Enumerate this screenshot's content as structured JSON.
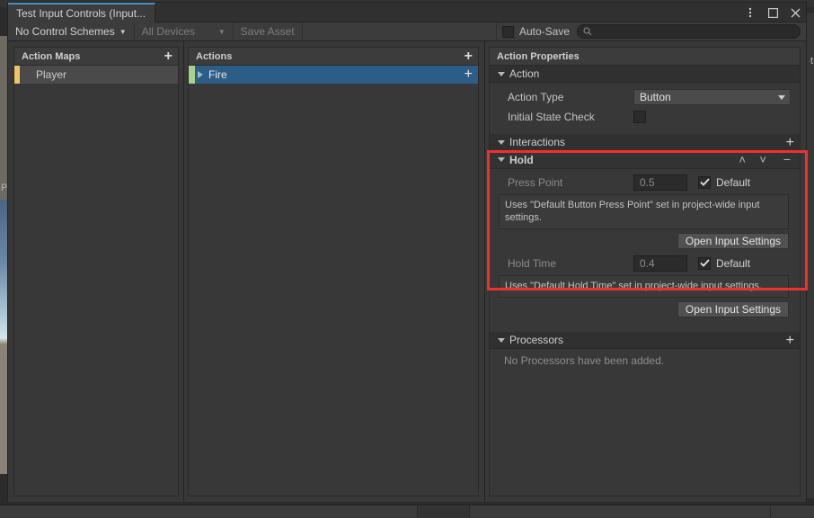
{
  "window": {
    "tab_title": "Test Input Controls (Input...",
    "buttons": {
      "menu": "⋮",
      "maximize": "❐",
      "close": "✕"
    }
  },
  "toolbar": {
    "control_schemes": "No Control Schemes",
    "devices": "All Devices",
    "save_asset": "Save Asset",
    "auto_save": "Auto-Save",
    "search_placeholder": ""
  },
  "action_maps": {
    "header": "Action Maps",
    "add_label": "+",
    "items": [
      {
        "name": "Player",
        "selected": false
      }
    ]
  },
  "actions": {
    "header": "Actions",
    "add_label": "+",
    "items": [
      {
        "name": "Fire",
        "selected": true,
        "add_label": "+"
      }
    ]
  },
  "properties": {
    "header": "Action Properties",
    "action_section": {
      "title": "Action",
      "action_type_label": "Action Type",
      "action_type_value": "Button",
      "initial_state_label": "Initial State Check",
      "initial_state_checked": false
    },
    "interactions_section": {
      "title": "Interactions",
      "add_label": "+",
      "items": [
        {
          "title": "Hold",
          "move_up": "˄",
          "move_down": "˅",
          "remove": "−",
          "fields": [
            {
              "label": "Press Point",
              "value": "0.5",
              "default_label": "Default",
              "default_checked": true,
              "help": "Uses \"Default Button Press Point\" set in project-wide input settings.",
              "button": "Open Input Settings"
            },
            {
              "label": "Hold Time",
              "value": "0.4",
              "default_label": "Default",
              "default_checked": true,
              "help": "Uses \"Default Hold Time\" set in project-wide input settings.",
              "button": "Open Input Settings"
            }
          ]
        }
      ]
    },
    "processors_section": {
      "title": "Processors",
      "add_label": "+",
      "empty_text": "No Processors have been added."
    }
  },
  "background": {
    "hierarchy_letter": "P",
    "right_letter": "t"
  },
  "colors": {
    "accent_blue": "#2c5d87",
    "tab_accent": "#4a8ec2",
    "map_accent": "#f2c46a",
    "action_accent": "#a9d08e",
    "highlight_red": "#f0302e",
    "panel_bg": "#383838"
  }
}
